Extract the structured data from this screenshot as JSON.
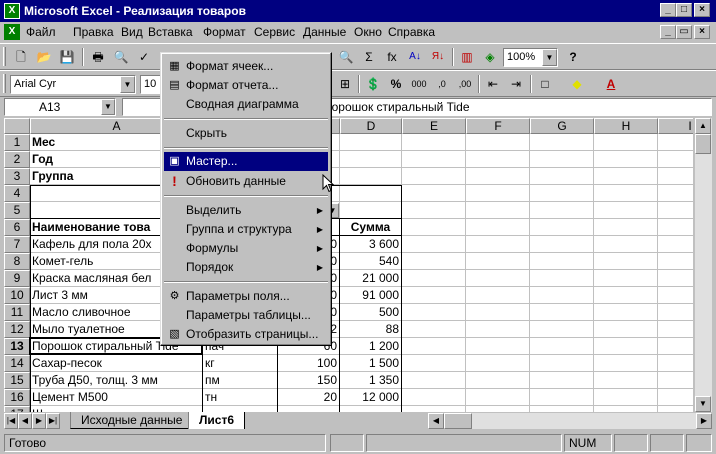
{
  "window": {
    "app_icon": "X",
    "title": "Microsoft Excel - Реализация товаров",
    "buttons": [
      "_",
      "□",
      "×"
    ]
  },
  "menubar": {
    "doc_icon": "X",
    "items": [
      "Файл",
      "Правка",
      "Вид",
      "Вставка",
      "Формат",
      "Сервис",
      "Данные",
      "Окно",
      "Справка"
    ],
    "doc_buttons": [
      "_",
      "▭",
      "×"
    ]
  },
  "toolbar_standard": {
    "icons": [
      "new-icon",
      "open-icon",
      "save-icon",
      "print-icon",
      "preview-icon",
      "spell-icon",
      "cut-icon",
      "help-icon",
      "sum-icon",
      "function-icon",
      "sort-asc-icon",
      "sort-desc-icon",
      "chart-icon",
      "map-icon"
    ],
    "glyphs": {
      "new": "🗋",
      "open": "📂",
      "save": "💾",
      "print": "🖶",
      "preview": "🔍",
      "spell": "✓",
      "sum": "Σ",
      "fx": "fx",
      "sort_asc": "A↓",
      "sort_desc": "Я↓",
      "chart": "▥",
      "map": "◈",
      "help": "?"
    },
    "zoom": "100%"
  },
  "toolbar_format": {
    "font": "Arial Cyr",
    "size": "10",
    "glyphs": {
      "merge": "⊞",
      "currency": "💲",
      "percent": "%",
      "thousands": "000",
      "dec_inc": ",0",
      "dec_dec": ",00",
      "indent_dec": "⇤",
      "indent_inc": "⇥",
      "borders": "□",
      "fill": "◆",
      "font_color": "A"
    }
  },
  "formula": {
    "namebox": "A13",
    "value": "Порошок стиральный Tide"
  },
  "columns": [
    "A",
    "B",
    "C",
    "D",
    "E",
    "F",
    "G",
    "H",
    "I"
  ],
  "rows": [
    "1",
    "2",
    "3",
    "4",
    "5",
    "6",
    "7",
    "8",
    "9",
    "10",
    "11",
    "12",
    "13",
    "14",
    "15",
    "16",
    "17"
  ],
  "active_row": "13",
  "cells": {
    "labels": {
      "r1": "Мес",
      "r2": "Год",
      "r3": "Группа"
    },
    "header": {
      "name": "Наименование това",
      "sum": "Сумма"
    },
    "items": [
      {
        "name": "Кафель для пола 20х",
        "unit": "",
        "qty": "0",
        "sum": "3 600"
      },
      {
        "name": "Комет-гель",
        "unit": "",
        "qty": "0",
        "sum": "540"
      },
      {
        "name": "Краска масляная бел",
        "unit": "",
        "qty": "0",
        "sum": "21 000"
      },
      {
        "name": "Лист 3 мм",
        "unit": "",
        "qty": "0",
        "sum": "91 000"
      },
      {
        "name": "Масло сливочное",
        "unit": "",
        "qty": "0",
        "sum": "500"
      },
      {
        "name": "Мыло туалетное",
        "unit": "",
        "qty": "2",
        "sum": "88"
      },
      {
        "name": "Порошок стиральный Tide",
        "unit": "пач",
        "qty": "60",
        "sum": "1 200"
      },
      {
        "name": "Сахар-песок",
        "unit": "кг",
        "qty": "100",
        "sum": "1 500"
      },
      {
        "name": "Труба Д50, толщ. 3 мм",
        "unit": "пм",
        "qty": "150",
        "sum": "1 350"
      },
      {
        "name": "Цемент М500",
        "unit": "тн",
        "qty": "20",
        "sum": "12 000"
      },
      {
        "name": "Ш",
        "unit": "",
        "qty": "",
        "sum": ""
      }
    ]
  },
  "context_menu": {
    "items": [
      {
        "label": "Формат ячеек...",
        "icon": "▦",
        "name": "format-cells"
      },
      {
        "label": "Формат отчета...",
        "icon": "▤",
        "name": "format-report"
      },
      {
        "label": "Сводная диаграмма",
        "icon": "",
        "name": "pivot-chart"
      },
      {
        "label": "Скрыть",
        "icon": "",
        "name": "hide"
      },
      {
        "label": "Мастер...",
        "icon": "▣",
        "name": "wizard"
      },
      {
        "label": "Обновить данные",
        "icon": "!",
        "name": "refresh-data"
      },
      {
        "label": "Выделить",
        "icon": "",
        "name": "select",
        "sub": "▶"
      },
      {
        "label": "Группа и структура",
        "icon": "",
        "name": "group-outline",
        "sub": "▶"
      },
      {
        "label": "Формулы",
        "icon": "",
        "name": "formulas",
        "sub": "▶"
      },
      {
        "label": "Порядок",
        "icon": "",
        "name": "order",
        "sub": "▶"
      },
      {
        "label": "Параметры поля...",
        "icon": "⚙",
        "name": "field-settings"
      },
      {
        "label": "Параметры таблицы...",
        "icon": "",
        "name": "table-options"
      },
      {
        "label": "Отобразить страницы...",
        "icon": "▧",
        "name": "show-pages"
      }
    ]
  },
  "sheet_tabs": [
    "Исходные данные",
    "Лист6"
  ],
  "tabnav": [
    "|◀",
    "◀",
    "▶",
    "▶|"
  ],
  "status": {
    "ready": "Готово",
    "num": "NUM"
  },
  "scroll": {
    "up": "▲",
    "down": "▼",
    "left": "◀",
    "right": "▶",
    "dropdown": "▼"
  }
}
